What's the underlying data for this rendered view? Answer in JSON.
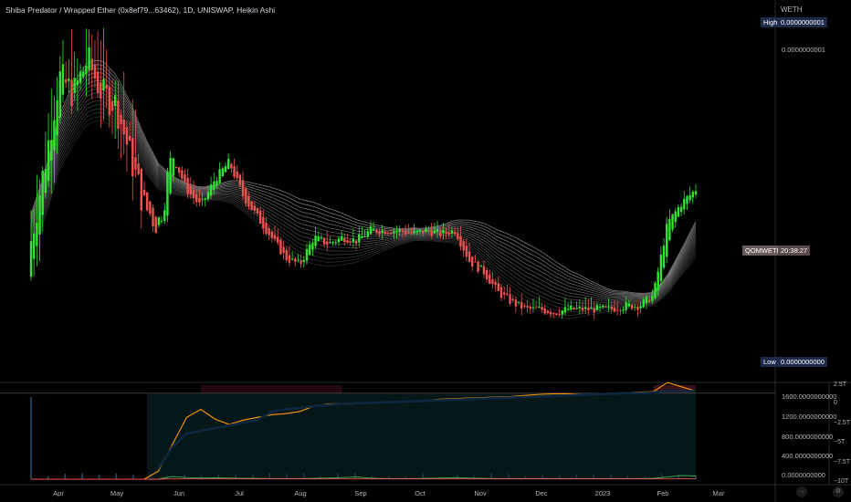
{
  "header": {
    "title": "Shiba Predator / Wrapped Ether (0x8ef79...63462), 1D, UNISWAP, Heikin Ashi",
    "quote_currency": "WETH"
  },
  "price_scale": {
    "high_label": "High",
    "high_value": "0.0000000001",
    "level_label": "0.0000000001",
    "low_label": "Low",
    "low_value": "0.0000000000",
    "last_symbol": "QOMWETH",
    "countdown": "20:38:27"
  },
  "indicator_scale": {
    "left_ticks": [
      "1600.0000000000",
      "1200.0000000000",
      "800.0000000000",
      "400.0000000000",
      "0.0000000000"
    ],
    "right_ticks": [
      "2.5T",
      "0",
      "−2.5T",
      "−5T",
      "−7.5T",
      "−10T"
    ]
  },
  "time_axis": {
    "labels": [
      "Apr",
      "May",
      "Jun",
      "Jul",
      "Aug",
      "Sep",
      "Oct",
      "Nov",
      "Dec",
      "2023",
      "Feb",
      "Mar"
    ]
  },
  "controls": {
    "goto_icon": "→",
    "settings_icon": "⚙"
  },
  "colors": {
    "up": "#26a69a",
    "up_bright": "#2ee62e",
    "down": "#ef5350",
    "ribbon": "#d9d9d9",
    "orange": "#ff9800",
    "green": "#4caf50",
    "navy": "#0d2740"
  },
  "chart_data": [
    {
      "type": "candlestick",
      "title": "",
      "series_style": "Heikin Ashi",
      "x": [
        "Mar 25",
        "Apr 1",
        "Apr 8",
        "Apr 15",
        "Apr 22",
        "Apr 29",
        "May 6",
        "May 13",
        "May 20",
        "May 27",
        "Jun 3",
        "Jun 10",
        "Jun 17",
        "Jun 24",
        "Jul 1",
        "Jul 8",
        "Jul 15",
        "Jul 22",
        "Jul 29",
        "Aug 5",
        "Aug 12",
        "Aug 19",
        "Aug 26",
        "Sep 2",
        "Sep 9",
        "Sep 16",
        "Sep 23",
        "Sep 30",
        "Oct 7",
        "Oct 14",
        "Oct 21",
        "Oct 28",
        "Nov 4",
        "Nov 11",
        "Nov 18",
        "Nov 25",
        "Dec 2",
        "Dec 9",
        "Dec 16",
        "Dec 23",
        "Dec 30",
        "Jan 6",
        "Jan 13",
        "Jan 20",
        "Jan 27",
        "Feb 3",
        "Feb 10",
        "Feb 17"
      ],
      "close": [
        0.35,
        0.58,
        0.83,
        0.78,
        0.88,
        0.78,
        0.75,
        0.6,
        0.45,
        0.4,
        0.6,
        0.5,
        0.45,
        0.53,
        0.58,
        0.48,
        0.42,
        0.36,
        0.3,
        0.28,
        0.36,
        0.34,
        0.36,
        0.35,
        0.38,
        0.38,
        0.38,
        0.37,
        0.38,
        0.37,
        0.38,
        0.29,
        0.26,
        0.2,
        0.17,
        0.15,
        0.15,
        0.14,
        0.15,
        0.15,
        0.15,
        0.15,
        0.16,
        0.16,
        0.19,
        0.4,
        0.46,
        0.5
      ],
      "ribbon_center": [
        0.35,
        0.45,
        0.6,
        0.68,
        0.74,
        0.75,
        0.72,
        0.66,
        0.58,
        0.52,
        0.5,
        0.49,
        0.48,
        0.48,
        0.48,
        0.46,
        0.43,
        0.4,
        0.37,
        0.34,
        0.33,
        0.32,
        0.32,
        0.32,
        0.33,
        0.34,
        0.35,
        0.36,
        0.36,
        0.36,
        0.36,
        0.34,
        0.31,
        0.27,
        0.24,
        0.21,
        0.19,
        0.17,
        0.16,
        0.16,
        0.16,
        0.16,
        0.17,
        0.17,
        0.17,
        0.21,
        0.27,
        0.33
      ],
      "ylim": [
        0,
        1
      ]
    },
    {
      "type": "line",
      "title": "",
      "x": [
        "Mar 25",
        "Apr 1",
        "Apr 8",
        "Apr 15",
        "Apr 22",
        "Apr 29",
        "May 6",
        "May 13",
        "May 20",
        "May 27",
        "Jun 3",
        "Jun 10",
        "Jun 17",
        "Jun 24",
        "Jul 1",
        "Jul 8",
        "Jul 15",
        "Jul 22",
        "Jul 29",
        "Aug 5",
        "Aug 12",
        "Aug 19",
        "Aug 26",
        "Sep 2",
        "Sep 9",
        "Sep 16",
        "Sep 23",
        "Sep 30",
        "Oct 7",
        "Oct 14",
        "Oct 21",
        "Oct 28",
        "Nov 4",
        "Nov 11",
        "Nov 18",
        "Nov 25",
        "Dec 2",
        "Dec 9",
        "Dec 16",
        "Dec 23",
        "Dec 30",
        "Jan 6",
        "Jan 13",
        "Jan 20",
        "Jan 27",
        "Feb 3",
        "Feb 10",
        "Feb 17"
      ],
      "series": [
        {
          "values": [
            null,
            null,
            null,
            null,
            null,
            null,
            null,
            null,
            0,
            150,
            650,
            1150,
            1300,
            1120,
            1020,
            1100,
            1150,
            1200,
            1220,
            1260,
            1360,
            1400,
            1410,
            1420,
            1425,
            1430,
            1440,
            1450,
            1470,
            1490,
            1500,
            1510,
            1520,
            1530,
            1540,
            1560,
            1580,
            1590,
            1590,
            1580,
            1590,
            1600,
            1610,
            1620,
            1630,
            1800,
            1720,
            1640
          ]
        },
        {
          "values": [
            null,
            null,
            null,
            null,
            null,
            null,
            null,
            null,
            null,
            200,
            600,
            850,
            900,
            950,
            1000,
            1050,
            1100,
            1250,
            1300,
            1330,
            1360,
            1380,
            1400,
            1410,
            1420,
            1430,
            1440,
            1450,
            1460,
            1470,
            1480,
            1490,
            1500,
            1510,
            1520,
            1530,
            1540,
            1550,
            1560,
            1570,
            1580,
            1590,
            1600,
            1600,
            1610,
            1640,
            1640,
            1640
          ]
        },
        {
          "values": [
            0,
            0,
            0,
            0,
            0,
            0,
            0,
            0,
            0,
            0,
            50,
            30,
            20,
            25,
            20,
            15,
            15,
            10,
            10,
            10,
            15,
            20,
            30,
            40,
            20,
            10,
            10,
            10,
            15,
            20,
            30,
            20,
            15,
            10,
            10,
            10,
            10,
            10,
            10,
            10,
            10,
            10,
            10,
            10,
            15,
            40,
            70,
            60
          ]
        },
        {
          "values": [
            0,
            0,
            0,
            0,
            0,
            0,
            0,
            0,
            0,
            0,
            5,
            5,
            5,
            5,
            5,
            5,
            5,
            5,
            5,
            5,
            5,
            5,
            5,
            5,
            5,
            5,
            5,
            5,
            5,
            5,
            5,
            5,
            5,
            5,
            5,
            5,
            5,
            5,
            5,
            5,
            5,
            5,
            5,
            5,
            5,
            5,
            5,
            5
          ]
        }
      ],
      "ylim": [
        0,
        1750
      ]
    }
  ]
}
